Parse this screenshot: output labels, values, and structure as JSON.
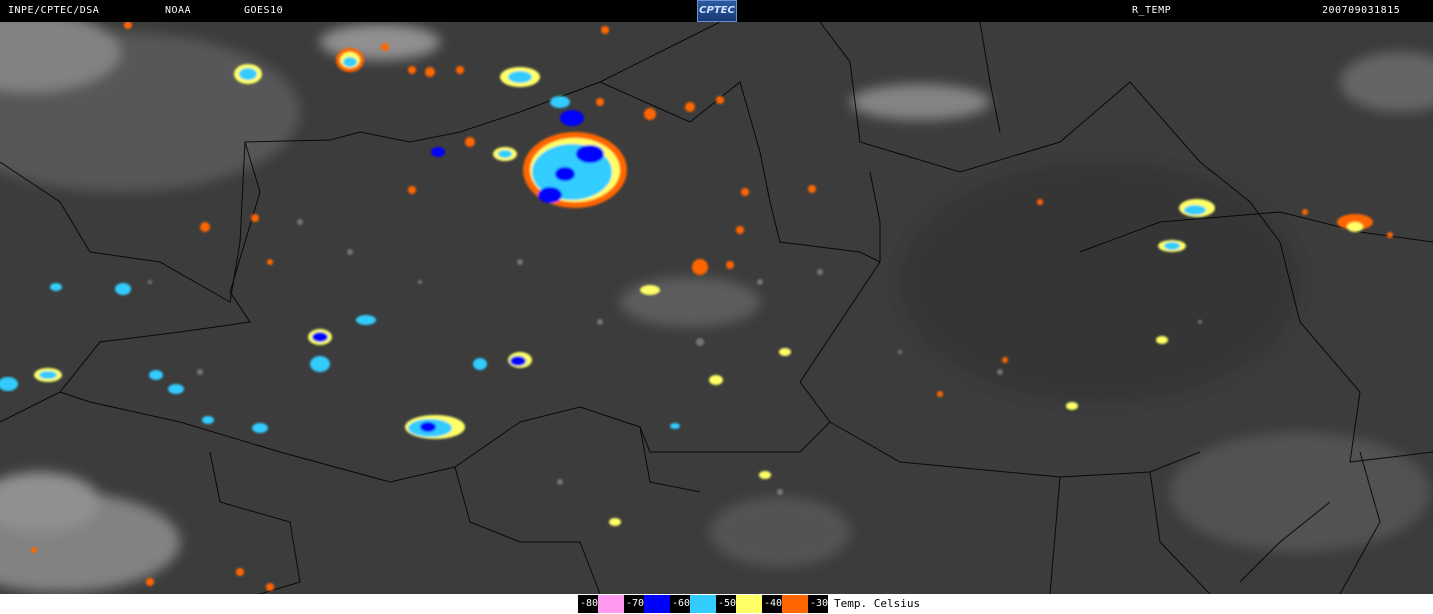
{
  "header": {
    "institution": "INPE/CPTEC/DSA",
    "agency": "NOAA",
    "satellite": "GOES10",
    "logo": "CPTEC",
    "product": "R_TEMP",
    "datetime": "200709031815"
  },
  "legend": {
    "entries": [
      {
        "value": "-80",
        "color": "#ff99ee"
      },
      {
        "value": "-70",
        "color": "#0000ff"
      },
      {
        "value": "-60",
        "color": "#33ccff"
      },
      {
        "value": "-50",
        "color": "#ffff66"
      },
      {
        "value": "-40",
        "color": "#ff6600"
      },
      {
        "value": "-30",
        "color": ""
      }
    ],
    "unit": "Temp. Celsius"
  },
  "colors": {
    "background": "#3c3c3c",
    "header_bg": "#000000",
    "footer_bg": "#ffffff",
    "border_lines": "#000000"
  }
}
